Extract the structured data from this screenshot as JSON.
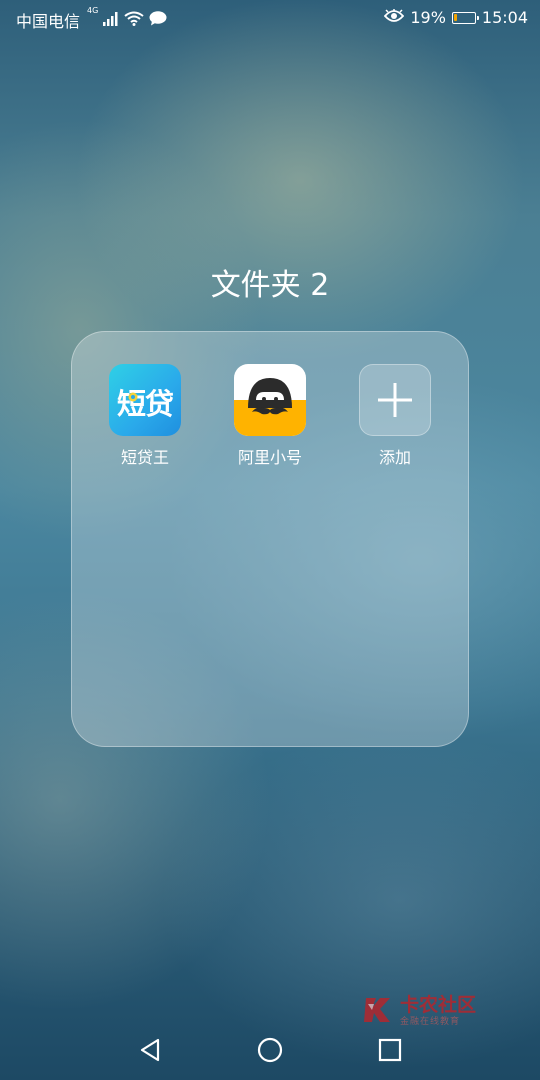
{
  "status_bar": {
    "carrier": "中国电信",
    "network_type": "4G",
    "battery_percent": "19%",
    "battery_level": 0.19,
    "battery_color": "#f1a400",
    "time": "15:04",
    "icons": [
      "signal-icon",
      "wifi-icon",
      "message-icon",
      "eye-icon",
      "battery-icon"
    ]
  },
  "folder": {
    "title": "文件夹 2",
    "apps": [
      {
        "label": "短贷王",
        "icon_text": "短贷",
        "icon": "duandaiwang-app-icon"
      },
      {
        "label": "阿里小号",
        "icon": "alixiaohao-app-icon"
      },
      {
        "label": "添加",
        "icon": "plus-icon"
      }
    ]
  },
  "watermark": {
    "title": "卡农社区",
    "subtitle": "金融在线教育"
  },
  "nav_bar": {
    "buttons": [
      "back-icon",
      "home-icon",
      "recents-icon"
    ]
  }
}
